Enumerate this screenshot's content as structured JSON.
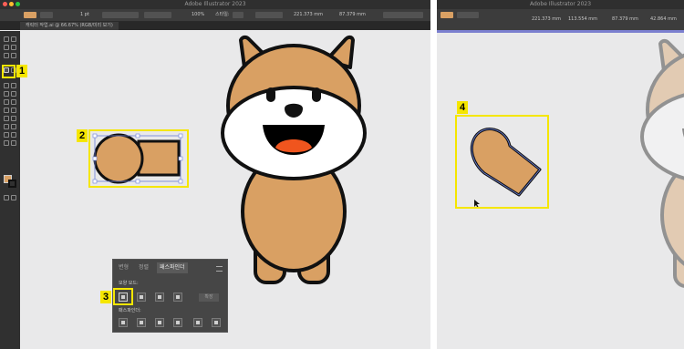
{
  "app": {
    "title": "Adobe Illustrator 2023"
  },
  "document_tab": {
    "label": "캐릭터 작업.ai @ 66.67% (RGB/미리 보기)"
  },
  "control_bar": {
    "stroke_weight": "1 pt",
    "opacity": "100%",
    "style_label": "스타일:",
    "x_value": "221.373 mm",
    "y_value": "113.554 mm",
    "w_value": "87.379 mm",
    "h_value": "42.864 mm"
  },
  "callouts": {
    "n1": "1",
    "n2": "2",
    "n3": "3",
    "n4": "4"
  },
  "pathfinder_panel": {
    "tabs": [
      "변형",
      "정렬",
      "패스파인더"
    ],
    "active_tab": "패스파인더",
    "shape_modes_label": "모양 모드:",
    "pathfinders_label": "패스파인더:",
    "expand_button": "확장"
  },
  "colors": {
    "highlight": "#f5e600",
    "dog_fur": "#d9a063",
    "dog_outline": "#111111",
    "tongue": "#f0551e",
    "mouth": "#000000",
    "fill_swatch": "#d9a063"
  },
  "icons": [
    "selection-icon",
    "direct-selection-icon",
    "pen-icon",
    "type-icon",
    "line-icon",
    "rectangle-icon",
    "brush-icon",
    "pencil-icon",
    "eraser-icon",
    "rotate-icon",
    "scale-icon",
    "width-icon",
    "shape-builder-icon",
    "perspective-icon",
    "mesh-icon",
    "gradient-icon",
    "eyedropper-icon",
    "blend-icon",
    "symbol-icon",
    "graph-icon",
    "artboard-icon",
    "slice-icon",
    "hand-icon",
    "zoom-icon",
    "unite-icon",
    "minus-front-icon",
    "intersect-icon",
    "exclude-icon",
    "divide-icon",
    "trim-icon",
    "merge-icon",
    "crop-icon",
    "outline-icon",
    "minus-back-icon",
    "cursor-arrow-icon"
  ]
}
